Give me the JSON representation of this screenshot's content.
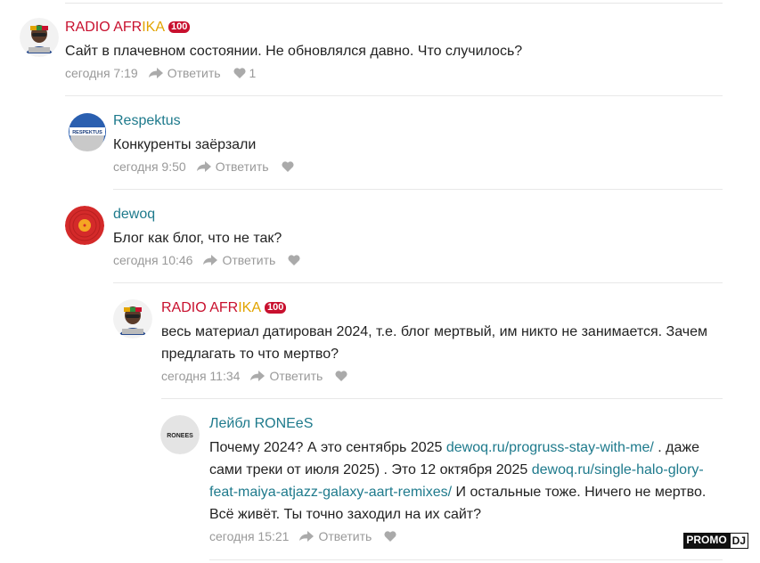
{
  "comments": [
    {
      "author": "RADIO AFR",
      "author_accent": "IKA",
      "badge": "100",
      "text": "Сайт в плачевном состоянии. Не обновлялся давно. Что случилось?",
      "time": "сегодня 7:19",
      "reply_label": "Ответить",
      "likes": "1"
    },
    {
      "author": "Respektus",
      "avatar_label": "RESPEKTUS",
      "text": "Конкуренты заёрзали",
      "time": "сегодня 9:50",
      "reply_label": "Ответить"
    },
    {
      "author": "dewoq",
      "text": "Блог как блог, что не так?",
      "time": "сегодня 10:46",
      "reply_label": "Ответить"
    },
    {
      "author": "RADIO AFR",
      "author_accent": "IKA",
      "badge": "100",
      "text": "весь материал датирован 2024, т.е. блог мертвый, им никто не занимается. Зачем предлагать то что мертво?",
      "time": "сегодня 11:34",
      "reply_label": "Ответить"
    },
    {
      "author": "Лейбл RONEeS",
      "avatar_label": "RONEES",
      "text_parts": {
        "t1": "Почему 2024? А это сентябрь 2025 ",
        "link1": "dewoq.ru/progruss-stay-with-me/",
        "t2": " . даже сами треки от июля 2025) . Это 12 октября 2025 ",
        "link2": "dewoq.ru/single-halo-glory-feat-maiya-atjazz-galaxy-aart-remixes/",
        "t3": " И остальные тоже. Ничего не мертво. Всё живёт. Ты точно заходил на их сайт?"
      },
      "time": "сегодня 15:21",
      "reply_label": "Ответить"
    }
  ],
  "watermark": {
    "part1": "PROMO",
    "part2": "DJ"
  },
  "icons": {
    "reply": "reply-arrow-icon",
    "like": "heart-icon"
  },
  "colors": {
    "author_red": "#c8102e",
    "author_teal": "#1e7a8c",
    "accent_yellow": "#e2a400",
    "meta_gray": "#999999"
  }
}
